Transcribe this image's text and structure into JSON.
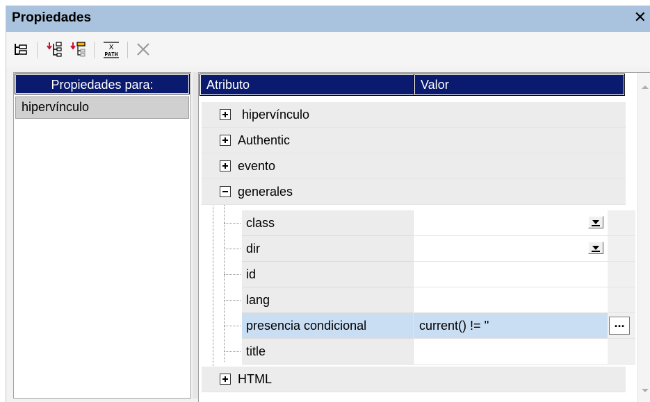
{
  "window": {
    "title": "Propiedades",
    "close_glyph": "✕"
  },
  "toolbar": {
    "buttons": [
      {
        "icon": "tree-layout-icon"
      },
      {
        "icon": "add-child-node-icon"
      },
      {
        "icon": "add-node-icon"
      },
      {
        "icon": "xpath-icon",
        "label": "X\nPATH"
      },
      {
        "icon": "delete-icon"
      }
    ]
  },
  "left_panel": {
    "header": "Propiedades para:",
    "items": [
      "hipervínculo"
    ]
  },
  "grid": {
    "columns": [
      "Atributo",
      "Valor"
    ],
    "groups": [
      {
        "label": "hipervínculo",
        "expanded": false
      },
      {
        "label": "Authentic",
        "expanded": false
      },
      {
        "label": "evento",
        "expanded": false
      },
      {
        "label": "generales",
        "expanded": true
      },
      {
        "label": "HTML",
        "expanded": false
      }
    ],
    "generales_children": [
      {
        "name": "class",
        "value": "",
        "has_dropdown": true
      },
      {
        "name": "dir",
        "value": "",
        "has_dropdown": true
      },
      {
        "name": "id",
        "value": ""
      },
      {
        "name": "lang",
        "value": ""
      },
      {
        "name": "presencia condicional",
        "value": "current() != ''",
        "selected": true,
        "ellipsis": "..."
      },
      {
        "name": "title",
        "value": ""
      }
    ]
  },
  "colors": {
    "header_bg": "#0a1a6e",
    "titlebar_bg": "#a9c2dd",
    "selection_bg": "#c9ddf3"
  }
}
